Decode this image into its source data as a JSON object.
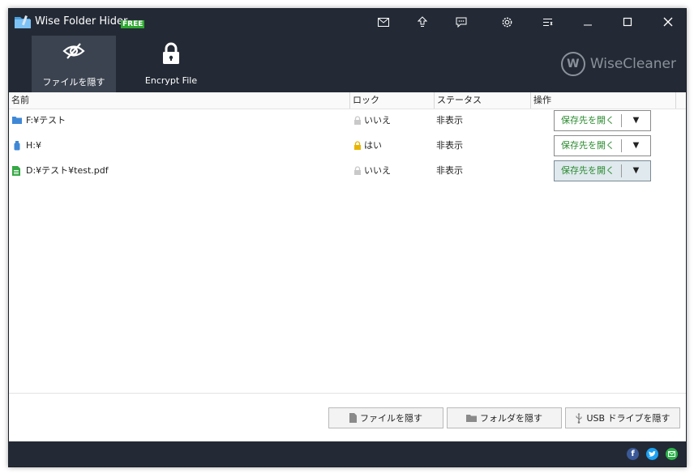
{
  "app": {
    "title": "Wise Folder Hider",
    "badge": "FREE"
  },
  "titlebar": {
    "icons": [
      "mail-icon",
      "upgrade-icon",
      "feedback-icon",
      "settings-icon",
      "menu-icon",
      "minimize-icon",
      "maximize-icon",
      "close-icon"
    ]
  },
  "nav": {
    "tabs": [
      {
        "label": "ファイルを隠す",
        "icon": "eye-slash-icon",
        "active": true
      },
      {
        "label": "Encrypt File",
        "icon": "lock-icon",
        "active": false
      }
    ]
  },
  "brand": {
    "logo_letter": "W",
    "name": "WiseCleaner"
  },
  "table": {
    "headers": [
      "名前",
      "ロック",
      "ステータス",
      "操作"
    ],
    "rows": [
      {
        "name": "F:¥テスト",
        "icon": "folder-icon",
        "lock": "いいえ",
        "locked": false,
        "status": "非表示",
        "action": "保存先を開く",
        "selected": false
      },
      {
        "name": "H:¥",
        "icon": "usb-drive-icon",
        "lock": "はい",
        "locked": true,
        "status": "非表示",
        "action": "保存先を開く",
        "selected": false
      },
      {
        "name": "D:¥テスト¥test.pdf",
        "icon": "file-icon",
        "lock": "いいえ",
        "locked": false,
        "status": "非表示",
        "action": "保存先を開く",
        "selected": true
      }
    ],
    "dropdown_glyph": "▼"
  },
  "actions": {
    "hide_file": "ファイルを隠す",
    "hide_folder": "フォルダを隠す",
    "hide_usb": "USB ドライブを隠す"
  },
  "footer": {
    "social": [
      "facebook-icon",
      "twitter-icon",
      "email-icon"
    ]
  },
  "colors": {
    "header_bg": "#232a35",
    "active_tab_bg": "#3b4350",
    "accent_green": "#2a8a2e",
    "free_badge": "#2da82f",
    "lock_yellow": "#e8b400",
    "facebook": "#3b5998",
    "twitter": "#1da1f2",
    "email": "#2db34a"
  }
}
